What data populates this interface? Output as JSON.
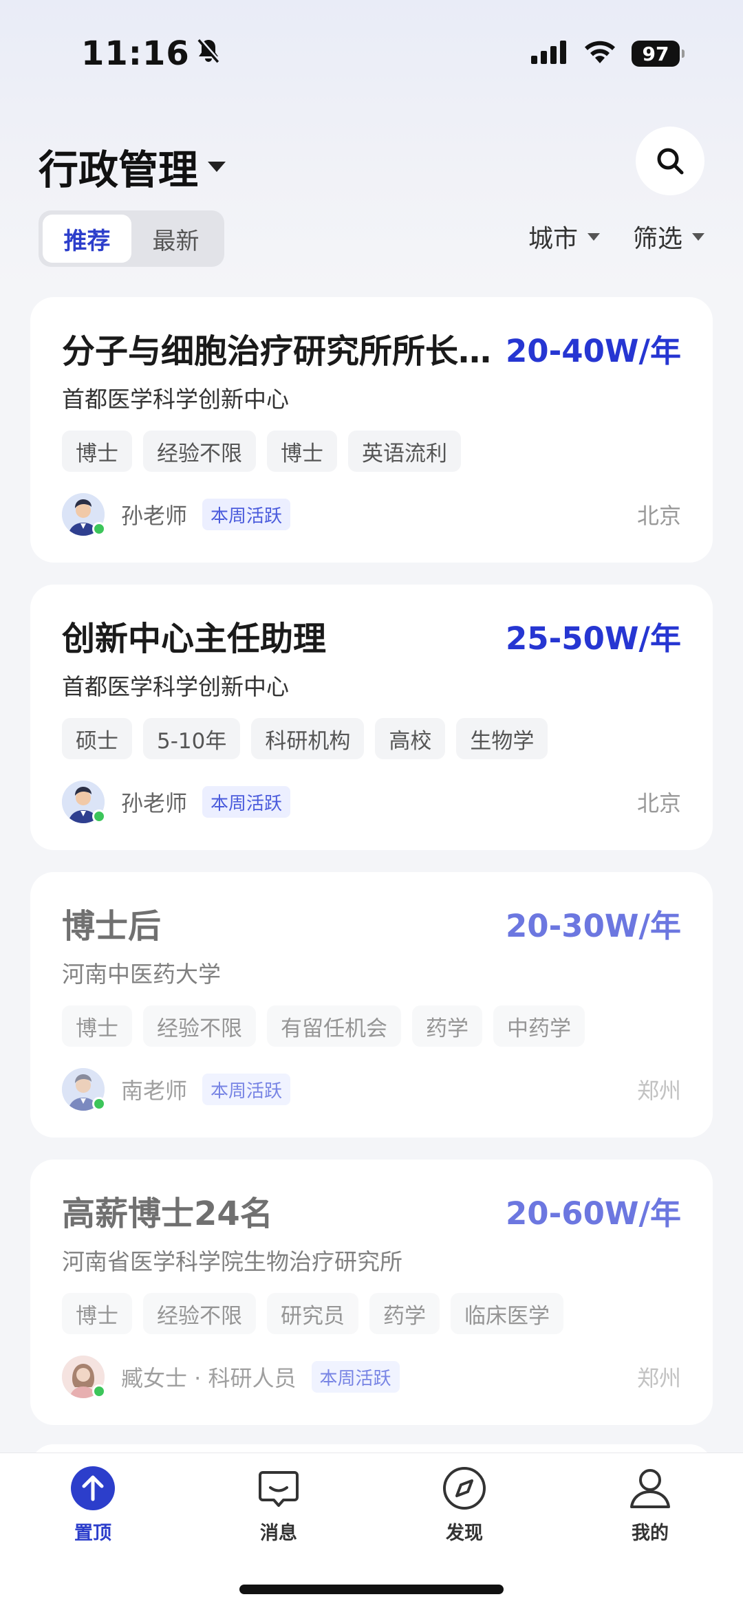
{
  "status_bar": {
    "time": "11:16",
    "battery": "97",
    "icons": [
      "bell-off-icon",
      "signal-icon",
      "wifi-icon",
      "battery-icon"
    ]
  },
  "header": {
    "title": "行政管理",
    "segments": [
      {
        "label": "推荐",
        "active": true
      },
      {
        "label": "最新",
        "active": false
      }
    ],
    "filters": [
      {
        "label": "城市"
      },
      {
        "label": "筛选"
      }
    ]
  },
  "jobs": [
    {
      "title": "分子与细胞治疗研究所所长…",
      "salary": "20-40W/年",
      "org": "首都医学科学创新中心",
      "tags": [
        "博士",
        "经验不限",
        "博士",
        "英语流利"
      ],
      "recruiter": "孙老师",
      "badge": "本周活跃",
      "city": "北京"
    },
    {
      "title": "创新中心主任助理",
      "salary": "25-50W/年",
      "org": "首都医学科学创新中心",
      "tags": [
        "硕士",
        "5-10年",
        "科研机构",
        "高校",
        "生物学"
      ],
      "recruiter": "孙老师",
      "badge": "本周活跃",
      "city": "北京"
    },
    {
      "title": "博士后",
      "salary": "20-30W/年",
      "org": "河南中医药大学",
      "tags": [
        "博士",
        "经验不限",
        "有留任机会",
        "药学",
        "中药学"
      ],
      "recruiter": "南老师",
      "badge": "本周活跃",
      "city": "郑州"
    },
    {
      "title": "高薪博士24名",
      "salary": "20-60W/年",
      "org": "河南省医学科学院生物治疗研究所",
      "tags": [
        "博士",
        "经验不限",
        "研究员",
        "药学",
        "临床医学"
      ],
      "recruiter": "臧女士 · 科研人员",
      "badge": "本周活跃",
      "city": "郑州"
    }
  ],
  "tabbar": [
    {
      "label": "置顶",
      "icon": "arrow-up-circle-icon",
      "active": true
    },
    {
      "label": "消息",
      "icon": "chat-bubble-icon",
      "active": false
    },
    {
      "label": "发现",
      "icon": "compass-icon",
      "active": false
    },
    {
      "label": "我的",
      "icon": "person-icon",
      "active": false
    }
  ],
  "colors": {
    "accent": "#2c3ecb",
    "salary": "#2636d2",
    "online": "#3cc55a",
    "badge_bg": "#ecefff"
  }
}
